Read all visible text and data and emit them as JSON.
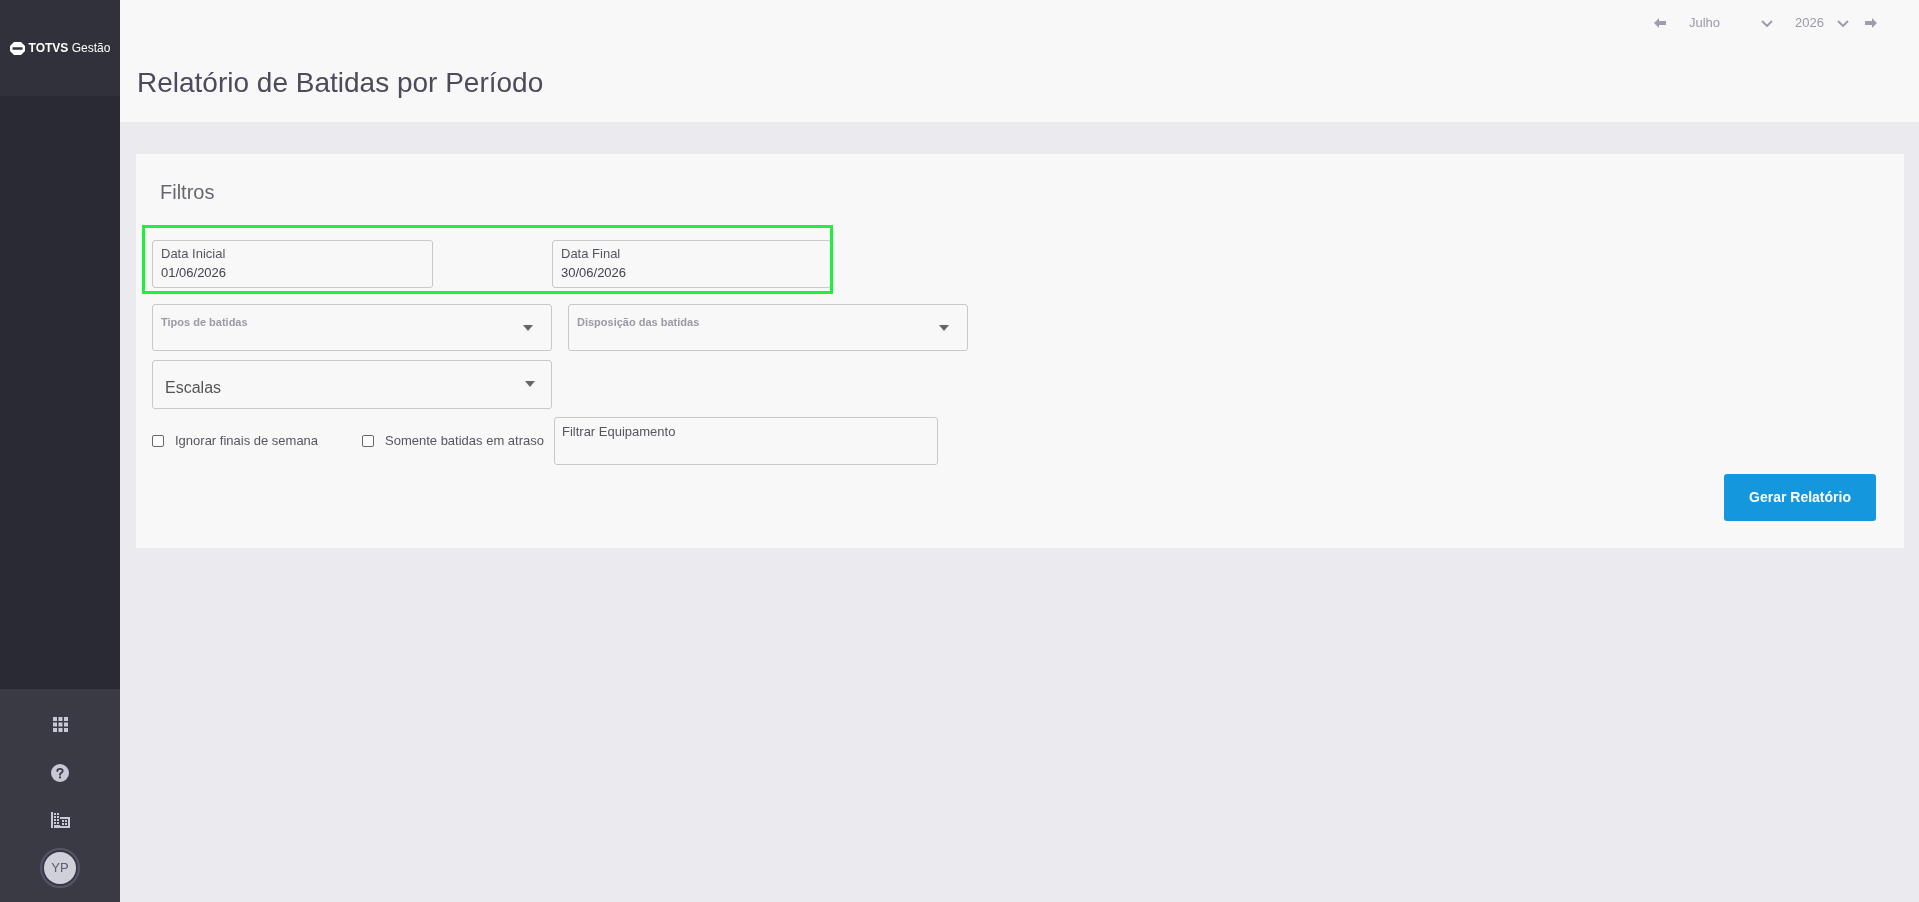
{
  "sidebar": {
    "logo": "**TOTVS** Gestão",
    "avatar": {
      "initials": "YP"
    }
  },
  "header": {
    "period": {
      "month": "Julho",
      "year": "2026"
    },
    "title": "Relatório de Batidas por Período"
  },
  "filters": {
    "title": "Filtros",
    "date_range": {
      "highlighted": true,
      "fields": [
        {
          "label": "Data Inicial",
          "value": "01/06/2026"
        },
        {
          "label": "Data Final",
          "value": "30/06/2026"
        }
      ]
    },
    "dropdowns": [
      {
        "label": "Tipos de batidas"
      },
      {
        "label": "Disposição das batidas"
      }
    ],
    "scales_dropdown": {
      "placeholder": "Escalas"
    },
    "checkboxes": [
      {
        "label": "Ignorar finais de semana",
        "checked": false
      },
      {
        "label": "Somente batidas em atraso",
        "checked": false
      }
    ],
    "equipment_field": {
      "placeholder": "Filtrar Equipamento"
    },
    "submit_button": "Gerar Relatório"
  }
}
